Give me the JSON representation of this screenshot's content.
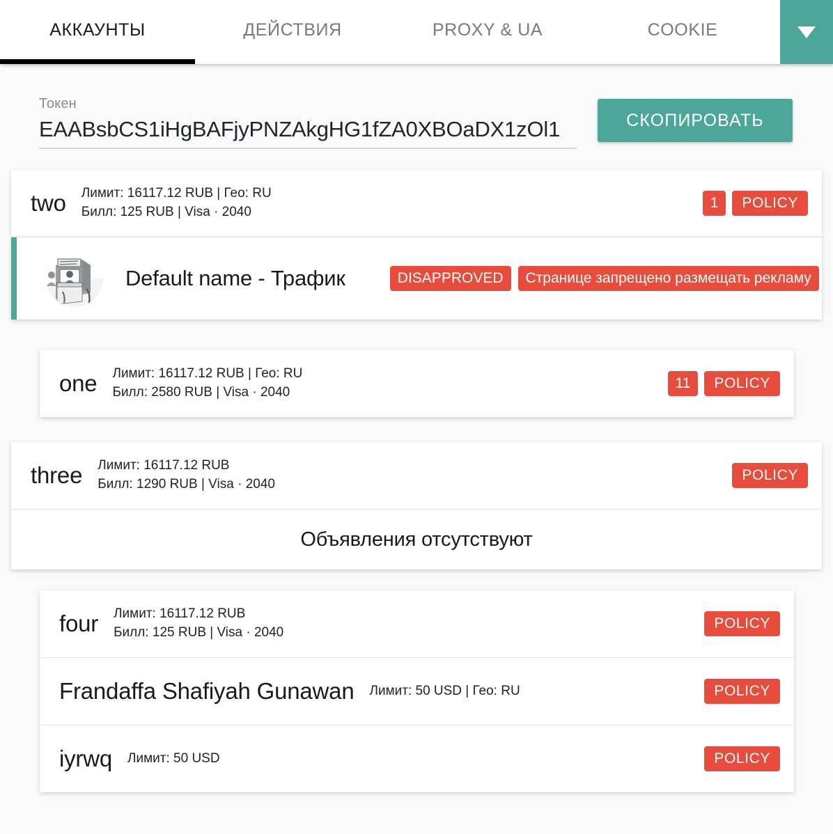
{
  "theme": {
    "accent_teal": "#4ca69a",
    "badge_red": "#e74c3c",
    "page_background": "#fafafa",
    "card_background": "#ffffff",
    "active_tab_underline": "#000000"
  },
  "tabs": [
    {
      "label": "АККАУНТЫ",
      "active": true
    },
    {
      "label": "ДЕЙСТВИЯ",
      "active": false
    },
    {
      "label": "PROXY & UA",
      "active": false
    },
    {
      "label": "COOKIE",
      "active": false
    }
  ],
  "tab_dropdown": {
    "icon": "chevron-down-icon"
  },
  "token": {
    "label": "Токен",
    "value": "EAABsbCS1iHgBAFjyPNZAkgHG1fZA0XBOaDX1zOl1",
    "copy_label": "СКОПИРОВАТЬ"
  },
  "accounts": [
    {
      "name": "two",
      "limit": "Лимит: 16117.12 RUB | Гео: RU",
      "bill": "Билл: 125 RUB | Visa · 2040",
      "count_badge": "1",
      "policy_badge": "POLICY"
    },
    {
      "name": "one",
      "limit": "Лимит: 16117.12 RUB | Гео: RU",
      "bill": "Билл: 2580 RUB | Visa · 2040",
      "count_badge": "11",
      "policy_badge": "POLICY"
    },
    {
      "name": "three",
      "limit": "Лимит: 16117.12 RUB",
      "bill": "Билл: 1290 RUB | Visa · 2040",
      "policy_badge": "POLICY"
    },
    {
      "name": "four",
      "limit": "Лимит: 16117.12 RUB",
      "bill": "Билл: 125 RUB | Visa · 2040",
      "policy_badge": "POLICY"
    },
    {
      "name": "Frandaffa Shafiyah Gunawan",
      "limit": "Лимит: 50 USD | Гео: RU",
      "policy_badge": "POLICY"
    },
    {
      "name": "iyrwq",
      "limit": "Лимит: 50 USD",
      "policy_badge": "POLICY"
    }
  ],
  "ad": {
    "thumbnail_icon": "ad-creative-thumbnail",
    "title": "Default name - Трафик",
    "status_badge": "DISAPPROVED",
    "reason_badge": "Странице запрещено размещать рекламу"
  },
  "empty_state": {
    "message": "Объявления отсутствуют"
  }
}
